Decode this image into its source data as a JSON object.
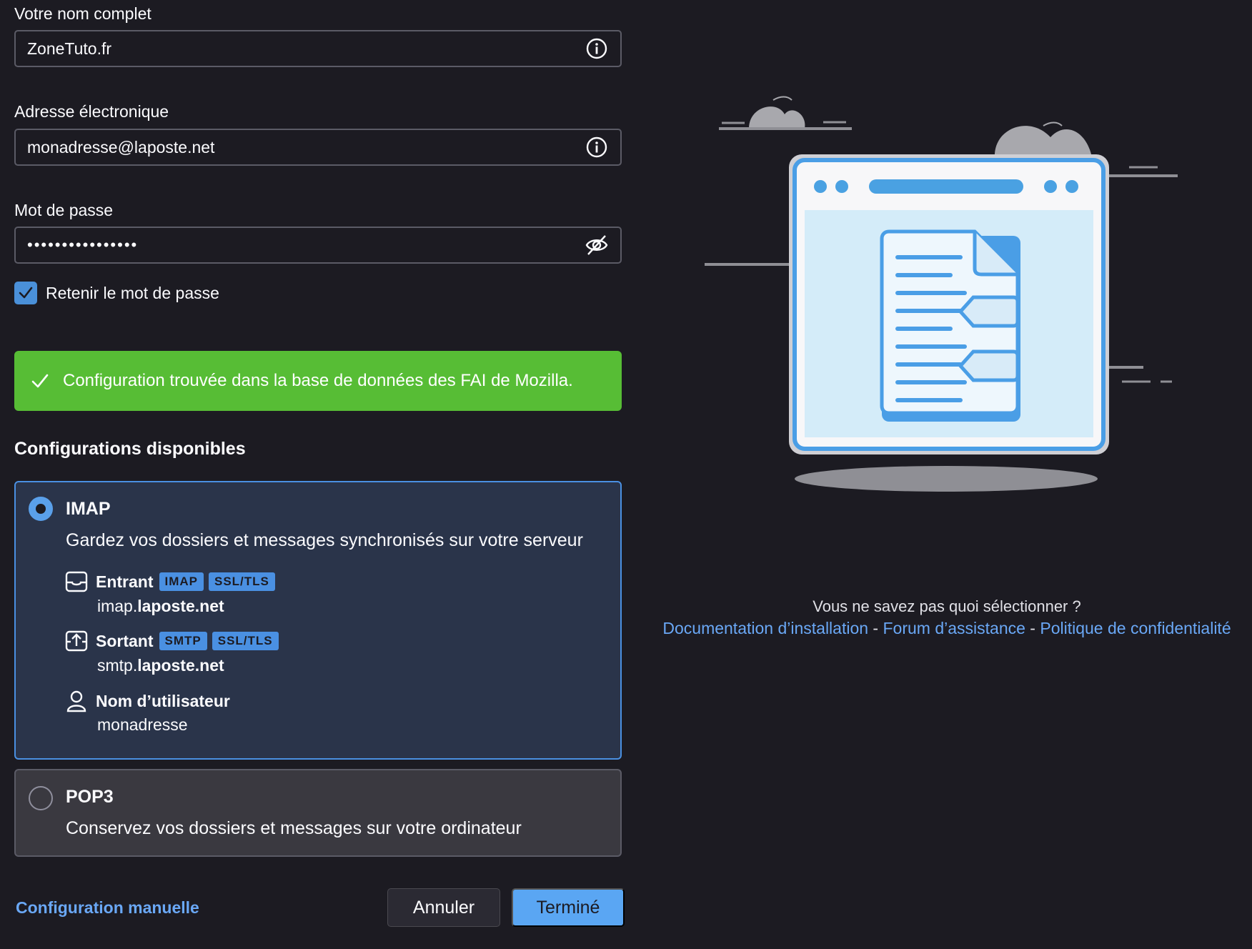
{
  "form": {
    "name_label": "Votre nom complet",
    "name_value": "ZoneTuto.fr",
    "email_label": "Adresse électronique",
    "email_value": "monadresse@laposte.net",
    "password_label": "Mot de passe",
    "password_value": "••••••••••••••••",
    "remember_label": "Retenir le mot de passe",
    "remember_checked": true
  },
  "banner": {
    "text": "Configuration trouvée dans la base de données des FAI de Mozilla.",
    "color": "#57bd35"
  },
  "configs": {
    "title": "Configurations disponibles",
    "imap": {
      "title": "IMAP",
      "desc": "Gardez vos dossiers et messages synchronisés sur votre serveur",
      "incoming_label": "Entrant",
      "incoming_badges": [
        "IMAP",
        "SSL/TLS"
      ],
      "incoming_host_prefix": "imap.",
      "incoming_host_domain": "laposte.net",
      "outgoing_label": "Sortant",
      "outgoing_badges": [
        "SMTP",
        "SSL/TLS"
      ],
      "outgoing_host_prefix": "smtp.",
      "outgoing_host_domain": "laposte.net",
      "username_label": "Nom d’utilisateur",
      "username_value": "monadresse"
    },
    "pop3": {
      "title": "POP3",
      "desc": "Conservez vos dossiers et messages sur votre ordinateur"
    }
  },
  "footer": {
    "manual_config": "Configuration manuelle",
    "cancel": "Annuler",
    "done": "Terminé"
  },
  "help": {
    "question": "Vous ne savez pas quoi sélectionner ?",
    "doc_link": "Documentation d’installation",
    "sep": " - ",
    "forum_link": "Forum d’assistance",
    "privacy_link": "Politique de confidentialité"
  },
  "colors": {
    "accent": "#4a90e2",
    "link": "#6aa8f6",
    "background": "#1c1b22"
  }
}
